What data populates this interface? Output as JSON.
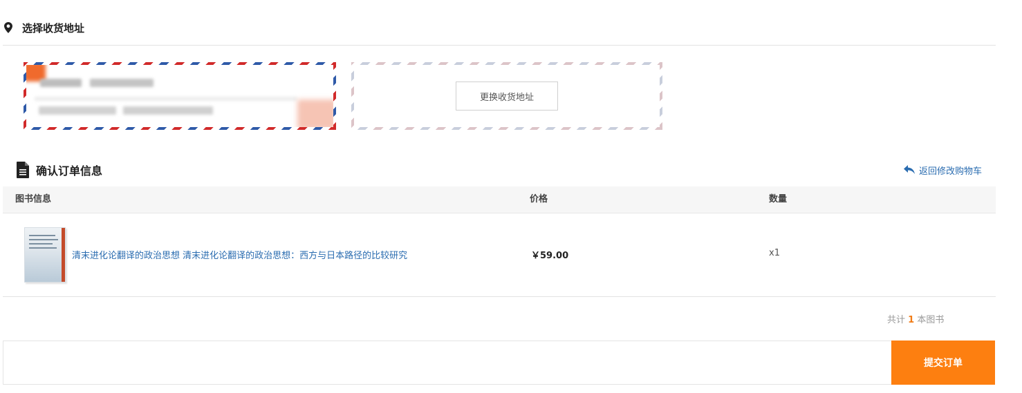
{
  "address_section": {
    "title": "选择收货地址",
    "change_button": "更换收货地址"
  },
  "order_section": {
    "title": "确认订单信息",
    "back_link": "返回修改购物车"
  },
  "table": {
    "headers": [
      "图书信息",
      "价格",
      "数量"
    ],
    "rows": [
      {
        "title": "清末进化论翻译的政治思想 清末进化论翻译的政治思想：西方与日本路径的比较研究",
        "price": "￥59.00",
        "qty": "x1"
      }
    ]
  },
  "summary": {
    "prefix": "共计",
    "count": "1",
    "suffix": "本图书"
  },
  "submit": {
    "label": "提交订单"
  },
  "colors": {
    "accent_orange": "#fd7f10",
    "link_blue": "#2a6cb0"
  },
  "icons": {
    "address": "map-marker-icon",
    "order": "document-icon",
    "back": "reply-arrow-icon"
  }
}
